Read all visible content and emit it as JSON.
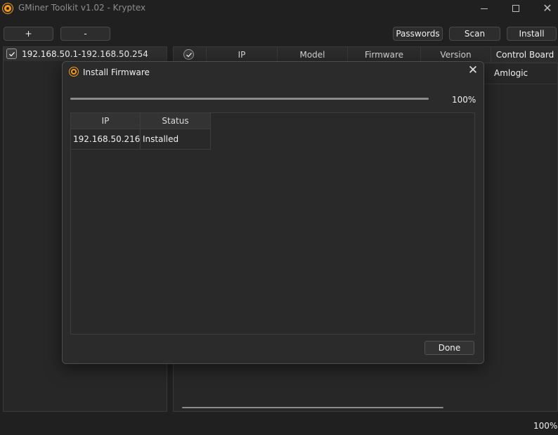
{
  "window": {
    "title": "GMiner Toolkit v1.02 - Kryptex",
    "close_glyph": "✕"
  },
  "toolbar": {
    "add_label": "+",
    "remove_label": "-",
    "passwords_label": "Passwords",
    "scan_label": "Scan",
    "install_label": "Install"
  },
  "ranges": [
    {
      "label": "192.168.50.1-192.168.50.254",
      "checked": true
    }
  ],
  "main_table": {
    "columns": [
      "IP",
      "Model",
      "Firmware",
      "Version",
      "Control Board"
    ],
    "visible_cell": "Amlogic"
  },
  "status_bar": {
    "percent": "100%"
  },
  "dialog": {
    "title": "Install Firmware",
    "close_glyph": "✕",
    "progress": {
      "value": 1.0,
      "label": "100%"
    },
    "columns": [
      "IP",
      "Status"
    ],
    "rows": [
      {
        "ip": "192.168.50.216",
        "status": "Installed"
      }
    ],
    "done_label": "Done"
  },
  "colors": {
    "background": "#202020",
    "accent_icon": "#f59a1f",
    "text": "#f0f0f0"
  },
  "icons": [
    "app-logo-icon",
    "minimize-icon",
    "maximize-icon",
    "close-icon",
    "checkmark-icon"
  ]
}
